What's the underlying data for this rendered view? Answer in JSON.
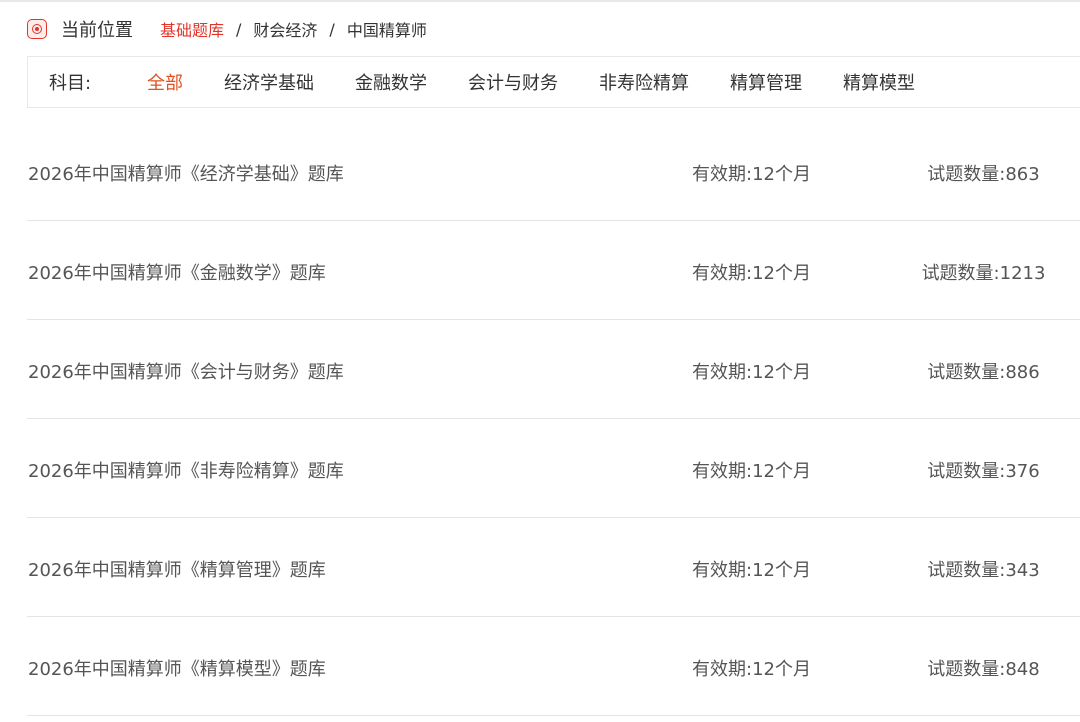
{
  "breadcrumb": {
    "current_label": "当前位置",
    "separator": "/",
    "items": [
      {
        "label": "基础题库",
        "active": true
      },
      {
        "label": "财会经济",
        "active": false
      },
      {
        "label": "中国精算师",
        "active": false
      }
    ]
  },
  "filter": {
    "label": "科目:",
    "tabs": [
      {
        "label": "全部",
        "active": true
      },
      {
        "label": "经济学基础",
        "active": false
      },
      {
        "label": "金融数学",
        "active": false
      },
      {
        "label": "会计与财务",
        "active": false
      },
      {
        "label": "非寿险精算",
        "active": false
      },
      {
        "label": "精算管理",
        "active": false
      },
      {
        "label": "精算模型",
        "active": false
      }
    ]
  },
  "question_banks": [
    {
      "title": "2026年中国精算师《经济学基础》题库",
      "validity": "有效期:12个月",
      "count": "试题数量:863"
    },
    {
      "title": "2026年中国精算师《金融数学》题库",
      "validity": "有效期:12个月",
      "count": "试题数量:1213"
    },
    {
      "title": "2026年中国精算师《会计与财务》题库",
      "validity": "有效期:12个月",
      "count": "试题数量:886"
    },
    {
      "title": "2026年中国精算师《非寿险精算》题库",
      "validity": "有效期:12个月",
      "count": "试题数量:376"
    },
    {
      "title": "2026年中国精算师《精算管理》题库",
      "validity": "有效期:12个月",
      "count": "试题数量:343"
    },
    {
      "title": "2026年中国精算师《精算模型》题库",
      "validity": "有效期:12个月",
      "count": "试题数量:848"
    }
  ],
  "colors": {
    "accent_red": "#e0352b",
    "active_tab": "#e0521f",
    "text": "#333333",
    "divider": "#e4e4e4"
  },
  "icons": {
    "location": "location-target-icon"
  }
}
